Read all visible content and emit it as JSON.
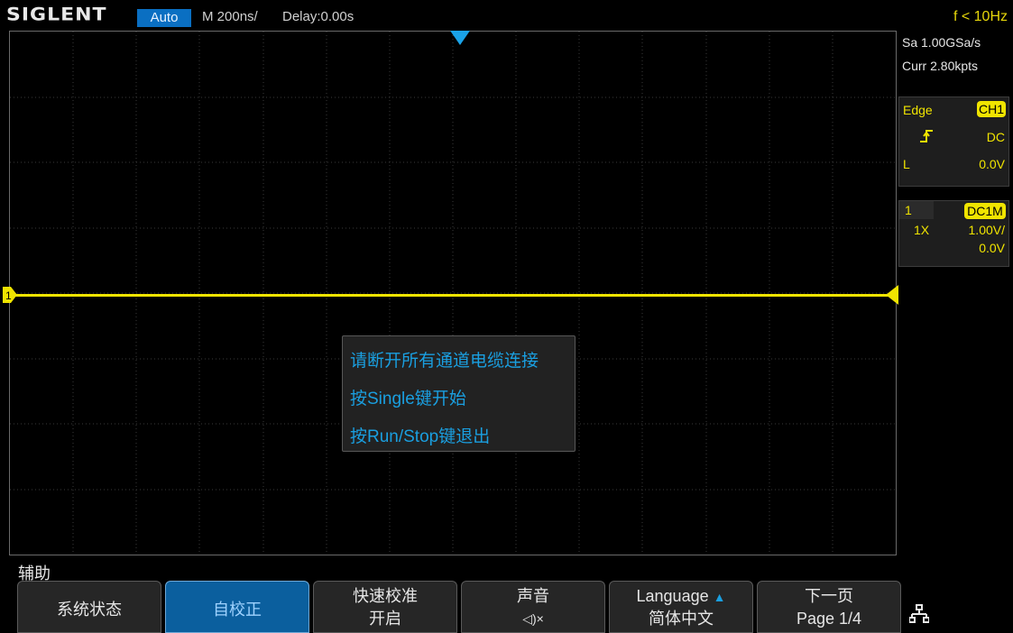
{
  "header": {
    "logo": "SIGLENT",
    "mode": "Auto",
    "timebase": "M 200ns/",
    "delay": "Delay:0.00s",
    "frequency": "f < 10Hz"
  },
  "acquisition": {
    "sample_rate": "Sa 1.00GSa/s",
    "memory_depth": "Curr 2.80kpts"
  },
  "trigger": {
    "type": "Edge",
    "source": "CH1",
    "slope_icon": "rising-edge-icon",
    "coupling": "DC",
    "level_label": "L",
    "level_value": "0.0V"
  },
  "channel": {
    "number": "1",
    "coupling_impedance": "DC1M",
    "probe": "1X",
    "scale": "1.00V/",
    "offset": "0.0V",
    "marker": "1",
    "color": "#f0e400"
  },
  "dialog": {
    "line1": "请断开所有通道电缆连接",
    "line2": "按Single键开始",
    "line3": "按Run/Stop键退出"
  },
  "menu": {
    "title": "辅助",
    "softkeys": [
      {
        "label": "系统状态"
      },
      {
        "label": "自校正",
        "active": true
      },
      {
        "label": "快速校准",
        "value": "开启"
      },
      {
        "label": "声音",
        "value": "◁)×"
      },
      {
        "label": "Language",
        "value": "简体中文"
      },
      {
        "label": "下一页",
        "value": "Page 1/4"
      }
    ],
    "network_icon": "network-icon"
  },
  "colors": {
    "accent": "#1a9fe0",
    "channel1": "#f0e400",
    "mode_bg": "#0a6fc2"
  }
}
